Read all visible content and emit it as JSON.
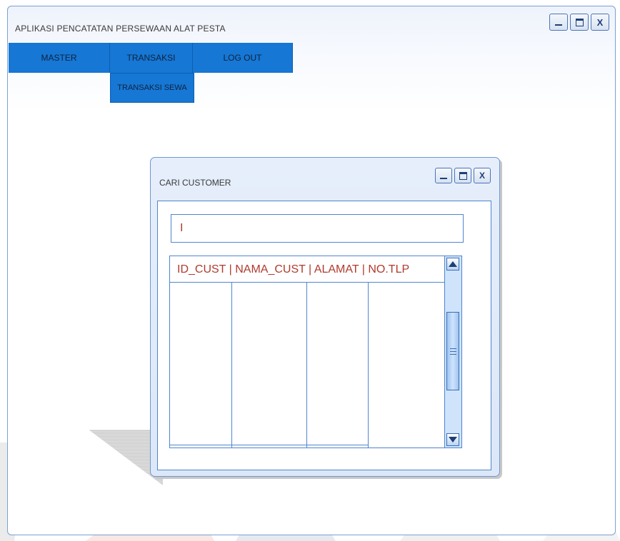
{
  "main_window": {
    "title": "APLIKASI PENCATATAN PERSEWAAN ALAT PESTA"
  },
  "menu": {
    "items": [
      {
        "label": "MASTER"
      },
      {
        "label": "TRANSAKSI"
      },
      {
        "label": "LOG OUT"
      }
    ],
    "submenu": {
      "label": "TRANSAKSI SEWA"
    }
  },
  "dialog": {
    "title": "CARI CUSTOMER",
    "search_value": "I",
    "table_header": "ID_CUST  |  NAMA_CUST  | ALAMAT  |  NO.TLP"
  },
  "icons": {
    "minimize": "minimize-icon",
    "maximize": "maximize-icon",
    "close": "close-icon",
    "close_glyph": "X"
  },
  "colors": {
    "menu_bg": "#1677d4",
    "window_border": "#7aa1d6",
    "header_text": "#b03a2e"
  }
}
